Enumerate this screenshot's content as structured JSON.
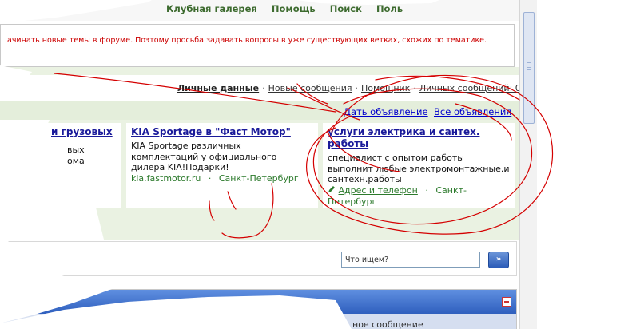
{
  "topnav": {
    "items": [
      "Клубная галерея",
      "Помощь",
      "Поиск",
      "Поль"
    ]
  },
  "notice": {
    "text": "ачинать новые темы в форуме. Поэтому просьба задавать вопросы в уже существующих ветках, схожих по тематике."
  },
  "usermenu": {
    "current": "Личные данные",
    "links": [
      "Новые сообщения",
      "Помощник",
      "Личных сообщений: 0"
    ],
    "separator": "·"
  },
  "ads": {
    "post_link": "Дать объявление",
    "all_link": "Все объявления",
    "items": [
      {
        "title": "и грузовых",
        "desc_lines": [
          "вых",
          "ома"
        ],
        "url": "",
        "region": ""
      },
      {
        "title": "KIA Sportage в \"Фаст Мотор\"",
        "desc_lines": [
          "KIA Sportage различных",
          "комплектаций у официального",
          "дилера KIA!Подарки!"
        ],
        "url": "kia.fastmotor.ru",
        "region": "Санкт-Петербург"
      },
      {
        "title": "услуги электрика и сантех. работы",
        "desc_lines": [
          "специалист с опытом работы",
          "выполнит любые электромонтажные.и",
          "сантехн.работы"
        ],
        "address_link": "Адрес и телефон",
        "region": "Санкт-Петербург"
      }
    ]
  },
  "search": {
    "value": "Что ищем?",
    "button_label": "»"
  },
  "forum_header": {
    "subheader": "ное сообщение"
  },
  "colors": {
    "scribble": "#d40000",
    "link": "#1a1a9a",
    "nav": "#3d6b2f",
    "accent_bar": "#2f5fbe"
  }
}
